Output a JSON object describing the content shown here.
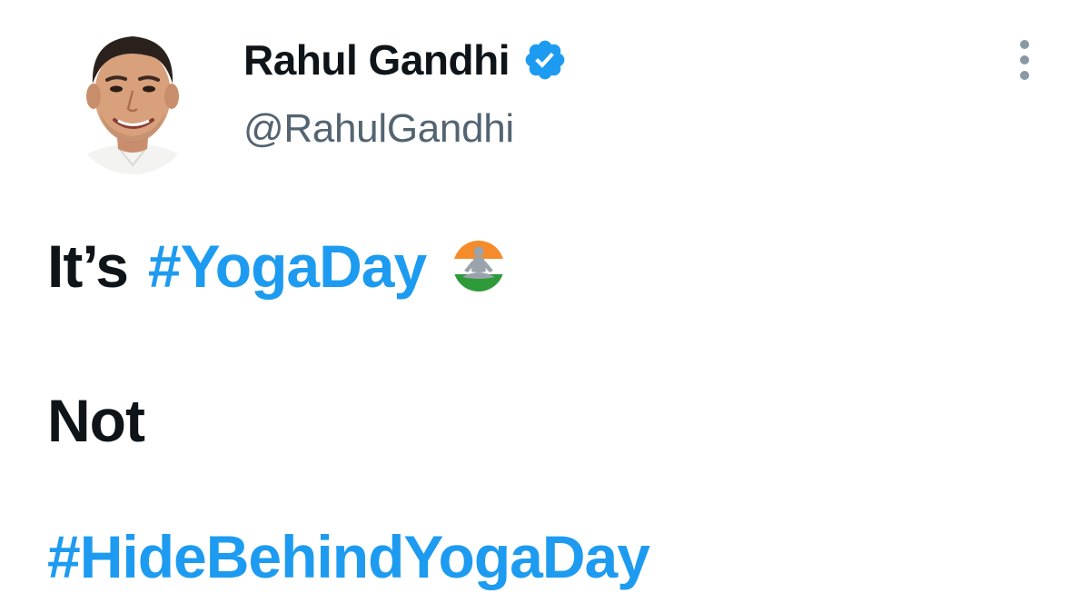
{
  "author": {
    "display_name": "Rahul Gandhi",
    "handle": "@RahulGandhi",
    "verified_icon": "verified-badge-icon",
    "avatar": "profile-photo"
  },
  "menu": {
    "icon": "more-options-icon"
  },
  "tweet": {
    "line1_text": "It’s",
    "line1_hashtag": "#YogaDay",
    "line1_emoji": "yoga-emoji-icon",
    "line2_text": "Not",
    "line3_hashtag": "#HideBehindYogaDay"
  },
  "colors": {
    "hashtag": "#1d9bf0",
    "verified": "#1d9bf0",
    "text": "#0f1419",
    "handle": "#536471"
  }
}
